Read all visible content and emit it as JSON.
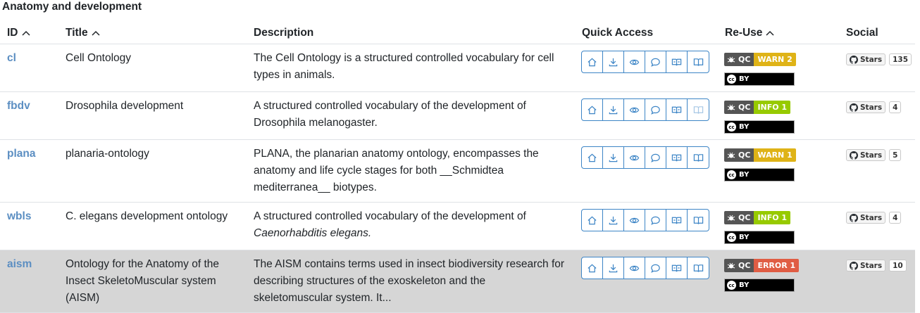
{
  "section": {
    "title": "Anatomy and development"
  },
  "headers": {
    "id": "ID",
    "title": "Title",
    "description": "Description",
    "quick_access": "Quick Access",
    "reuse": "Re-Use",
    "social": "Social"
  },
  "badge_labels": {
    "qc": "QC",
    "cc": "cc",
    "by": "BY",
    "stars": "Stars"
  },
  "colors": {
    "link": "#5b8ec2",
    "warn": "#dfb317",
    "info": "#97ca00",
    "error": "#e05d44",
    "button": "#3d85c6",
    "active_row": "#d6d6d6"
  },
  "quick_access_icons": [
    "home-icon",
    "download-icon",
    "eye-icon",
    "comment-icon",
    "book-open-icon",
    "book-icon"
  ],
  "rows": [
    {
      "id": "cl",
      "title": [
        "Cell Ontology"
      ],
      "description": [
        "The Cell Ontology is a structured controlled vocabulary for cell",
        "types in animals."
      ],
      "qc_status": "WARN 2",
      "qc_type": "warn",
      "stars": "135"
    },
    {
      "id": "fbdv",
      "title": [
        "Drosophila development"
      ],
      "description": [
        "A structured controlled vocabulary of the development of",
        "Drosophila melanogaster."
      ],
      "qc_status": "INFO 1",
      "qc_type": "info",
      "stars": "4"
    },
    {
      "id": "plana",
      "title": [
        "planaria-ontology"
      ],
      "description": [
        "PLANA, the planarian anatomy ontology, encompasses the",
        "anatomy and life cycle stages for both __Schmidtea",
        "mediterranea__ biotypes."
      ],
      "qc_status": "WARN 1",
      "qc_type": "warn",
      "stars": "5"
    },
    {
      "id": "wbls",
      "title": [
        "C. elegans development ontology"
      ],
      "description": [
        "A structured controlled vocabulary of the development of",
        "Caenorhabditis elegans."
      ],
      "desc_italic_line": 1,
      "qc_status": "INFO 1",
      "qc_type": "info",
      "stars": "4"
    },
    {
      "id": "aism",
      "title": [
        "Ontology for the Anatomy of the",
        "Insect SkeletoMuscular system",
        "(AISM)"
      ],
      "description": [
        "The AISM contains terms used in insect biodiversity research for",
        "describing structures of the exoskeleton and the",
        "skeletomuscular system. It..."
      ],
      "qc_status": "ERROR 1",
      "qc_type": "error",
      "stars": "10",
      "active": true
    }
  ]
}
